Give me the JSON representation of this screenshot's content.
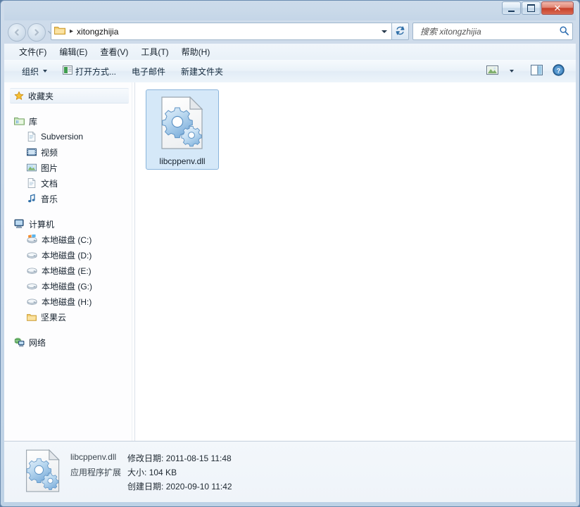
{
  "window": {
    "controls": {
      "minimize": "最小化",
      "maximize": "最大化",
      "close": "✕"
    }
  },
  "address": {
    "back_arrow": "◀",
    "forward_arrow": "▶",
    "history_caret": "▾",
    "crumb_separator": "▸",
    "path": "xitongzhijia",
    "refresh_label": "刷新"
  },
  "search": {
    "placeholder": "搜索 xitongzhijia",
    "value": ""
  },
  "menubar": {
    "items": [
      {
        "label": "文件(F)"
      },
      {
        "label": "编辑(E)"
      },
      {
        "label": "查看(V)"
      },
      {
        "label": "工具(T)"
      },
      {
        "label": "帮助(H)"
      }
    ]
  },
  "commandbar": {
    "organize": "组织",
    "open_with": "打开方式...",
    "email": "电子邮件",
    "new_folder": "新建文件夹",
    "view_label": "更改视图",
    "preview_label": "显示预览窗格",
    "help_label": "帮助"
  },
  "sidebar": {
    "favorites": {
      "label": "收藏夹"
    },
    "libraries": {
      "label": "库",
      "items": [
        {
          "label": "Subversion"
        },
        {
          "label": "视频"
        },
        {
          "label": "图片"
        },
        {
          "label": "文档"
        },
        {
          "label": "音乐"
        }
      ]
    },
    "computer": {
      "label": "计算机",
      "items": [
        {
          "label": "本地磁盘 (C:)"
        },
        {
          "label": "本地磁盘 (D:)"
        },
        {
          "label": "本地磁盘 (E:)"
        },
        {
          "label": "本地磁盘 (G:)"
        },
        {
          "label": "本地磁盘 (H:)"
        },
        {
          "label": "坚果云"
        }
      ]
    },
    "network": {
      "label": "网络"
    }
  },
  "content": {
    "files": [
      {
        "name": "libcppenv.dll",
        "selected": true
      }
    ]
  },
  "status": {
    "name": "libcppenv.dll",
    "type": "应用程序扩展",
    "modified_key": "修改日期:",
    "modified_value": "2011-08-15 11:48",
    "size_key": "大小:",
    "size_value": "104 KB",
    "created_key": "创建日期:",
    "created_value": "2020-09-10 11:42"
  },
  "colors": {
    "titlebar": "#c9d9e9",
    "selection": "#d5e8f8",
    "selection_border": "#8ab4dc",
    "close_button": "#c6402a",
    "accent": "#2b6cb0"
  }
}
